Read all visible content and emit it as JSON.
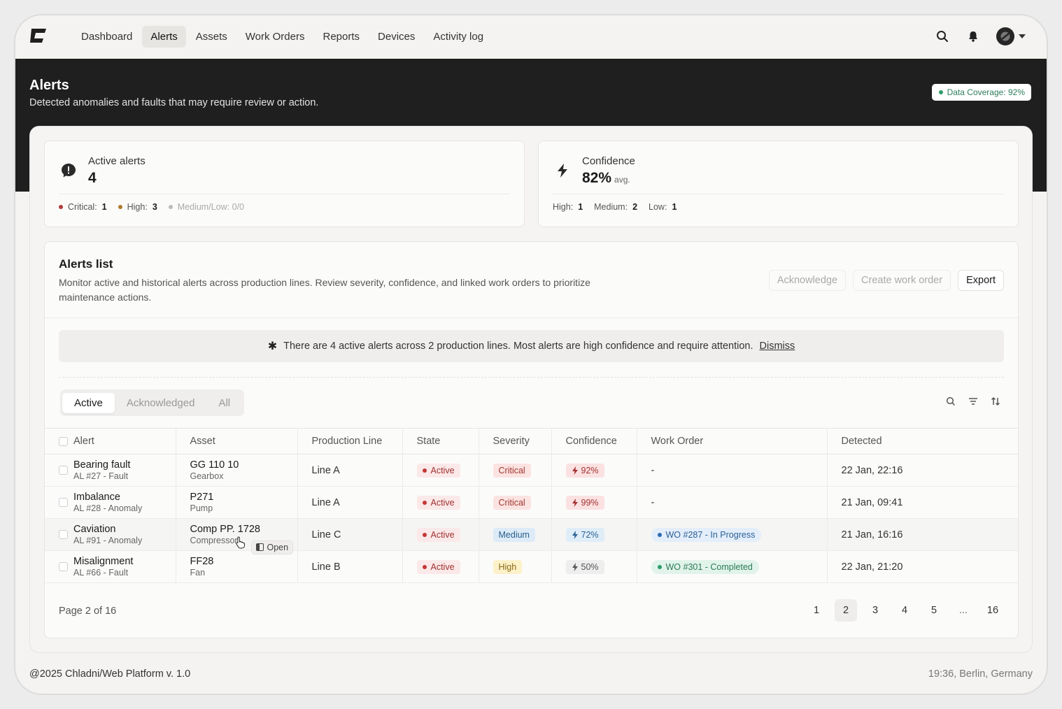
{
  "nav": {
    "items": [
      {
        "label": "Dashboard",
        "active": false
      },
      {
        "label": "Alerts",
        "active": true
      },
      {
        "label": "Assets",
        "active": false
      },
      {
        "label": "Work Orders",
        "active": false
      },
      {
        "label": "Reports",
        "active": false
      },
      {
        "label": "Devices",
        "active": false
      },
      {
        "label": "Activity log",
        "active": false
      }
    ],
    "icons": [
      "search-icon",
      "bell-icon",
      "avatar",
      "chevron-down-icon"
    ]
  },
  "header": {
    "title": "Alerts",
    "subtitle": "Detected anomalies and faults that may require review or action.",
    "coverage": "Data Coverage: 92%"
  },
  "stats": {
    "active": {
      "label": "Active alerts",
      "value": "4",
      "breakdown": [
        {
          "label": "Critical:",
          "value": "1",
          "color": "#b23a3a"
        },
        {
          "label": "High:",
          "value": "3",
          "color": "#b07a2a"
        },
        {
          "label": "Medium/Low: 0/0",
          "value": "",
          "color": "#bbbbbb"
        }
      ]
    },
    "confidence": {
      "label": "Confidence",
      "value": "82%",
      "unit": "avg.",
      "breakdown": [
        {
          "label": "High:",
          "value": "1"
        },
        {
          "label": "Medium:",
          "value": "2"
        },
        {
          "label": "Low:",
          "value": "1"
        }
      ]
    }
  },
  "list": {
    "title": "Alerts list",
    "description": "Monitor active and historical alerts across production lines. Review severity, confidence, and linked work orders to prioritize maintenance actions.",
    "actions": {
      "acknowledge": "Acknowledge",
      "create": "Create work order",
      "export": "Export"
    },
    "banner": {
      "text": "There are 4 active alerts across 2 production lines. Most alerts are high confidence and require attention.",
      "dismiss": "Dismiss"
    },
    "tabs": [
      {
        "label": "Active",
        "active": true
      },
      {
        "label": "Acknowledged",
        "active": false
      },
      {
        "label": "All",
        "active": false
      }
    ],
    "columns": [
      "Alert",
      "Asset",
      "Production Line",
      "State",
      "Severity",
      "Confidence",
      "Work Order",
      "Detected"
    ],
    "rows": [
      {
        "alert": "Bearing fault",
        "alert_sub": "AL #27 - Fault",
        "asset": "GG 110 10",
        "asset_sub": "Gearbox",
        "line": "Line A",
        "state": "Active",
        "severity": "Critical",
        "confidence": "92%",
        "work_order": "-",
        "detected": "22 Jan, 22:16"
      },
      {
        "alert": "Imbalance",
        "alert_sub": "AL #28 - Anomaly",
        "asset": "P271",
        "asset_sub": "Pump",
        "line": "Line A",
        "state": "Active",
        "severity": "Critical",
        "confidence": "99%",
        "work_order": "-",
        "detected": "21 Jan, 09:41"
      },
      {
        "alert": "Caviation",
        "alert_sub": "AL #91 - Anomaly",
        "asset": "Comp PP. 1728",
        "asset_sub": "Compressor",
        "line": "Line C",
        "state": "Active",
        "severity": "Medium",
        "confidence": "72%",
        "work_order": "WO #287 - In Progress",
        "detected": "21 Jan, 16:16"
      },
      {
        "alert": "Misalignment",
        "alert_sub": "AL #66 - Fault",
        "asset": "FF28",
        "asset_sub": "Fan",
        "line": "Line B",
        "state": "Active",
        "severity": "High",
        "confidence": "50%",
        "work_order": "WO #301 - Completed",
        "detected": "22 Jan, 21:20"
      }
    ],
    "open_tooltip": "Open",
    "pagination": {
      "label": "Page 2 of 16",
      "pages": [
        "1",
        "2",
        "3",
        "4",
        "5",
        "...",
        "16"
      ],
      "current": "2"
    }
  },
  "footer": {
    "copyright": "@2025 Chladni/Web Platform v. 1.0",
    "location": "19:36, Berlin, Germany"
  }
}
